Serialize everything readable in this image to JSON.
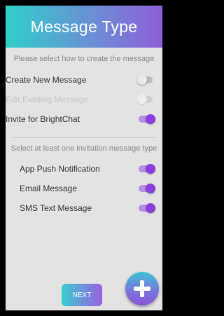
{
  "header": {
    "title": "Message Type"
  },
  "section1": {
    "hint": "Please select how to create the message",
    "options": [
      {
        "label": "Create New Message",
        "state": "off",
        "disabled": false
      },
      {
        "label": "Edit Existing Message",
        "state": "off",
        "disabled": true
      },
      {
        "label": "Invite for BrightChat",
        "state": "on",
        "disabled": false
      }
    ]
  },
  "section2": {
    "hint": "Select at least one invitation message type",
    "options": [
      {
        "label": "App Push Notification",
        "state": "on"
      },
      {
        "label": "Email Message",
        "state": "on"
      },
      {
        "label": "SMS Text Message",
        "state": "on"
      }
    ]
  },
  "footer": {
    "next_label": "NEXT",
    "fab_icon": "plus-icon"
  },
  "colors": {
    "accent": "#8a3fdc",
    "track_on": "#b48de6",
    "teal": "#2fd0c9"
  }
}
